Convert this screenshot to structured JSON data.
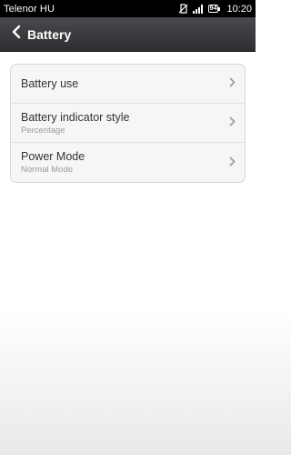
{
  "status_bar": {
    "carrier": "Telenor HU",
    "battery_level": "94",
    "time": "10:20"
  },
  "header": {
    "title": "Battery"
  },
  "settings": [
    {
      "label": "Battery use",
      "sub": ""
    },
    {
      "label": "Battery indicator style",
      "sub": "Percentage"
    },
    {
      "label": "Power Mode",
      "sub": "Normal Mode"
    }
  ]
}
